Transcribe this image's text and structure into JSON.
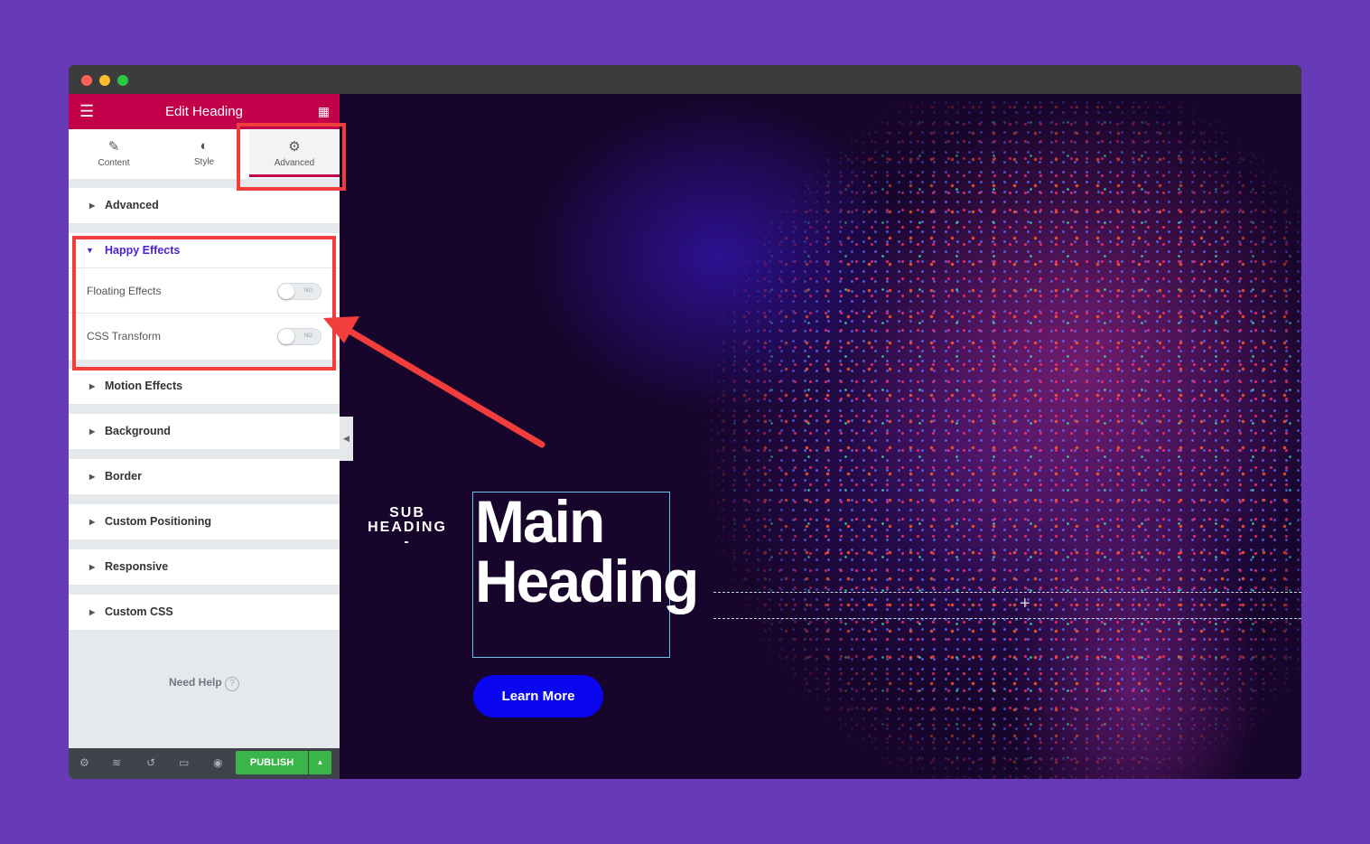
{
  "panel": {
    "title": "Edit Heading",
    "tabs": [
      {
        "label": "Content",
        "icon": "pencil-icon"
      },
      {
        "label": "Style",
        "icon": "half-circle-icon"
      },
      {
        "label": "Advanced",
        "icon": "gear-icon",
        "active": true
      }
    ],
    "sections": [
      "Advanced",
      "Motion Effects",
      "Background",
      "Border",
      "Custom Positioning",
      "Responsive",
      "Custom CSS"
    ],
    "happy_effects": {
      "title": "Happy Effects",
      "controls": [
        {
          "label": "Floating Effects",
          "state": "NO"
        },
        {
          "label": "CSS Transform",
          "state": "NO"
        }
      ]
    },
    "help": "Need Help",
    "publish": "PUBLISH"
  },
  "canvas": {
    "sub_heading": "SUB HEADING",
    "sub_dash": "-",
    "main_heading": "Main Heading",
    "button": "Learn More"
  },
  "colors": {
    "background": "#673ab7",
    "header": "#c3004a",
    "accent": "#4a1ed6",
    "publish": "#39b54a",
    "button": "#0a06f0",
    "highlight": "#f23d3d"
  }
}
